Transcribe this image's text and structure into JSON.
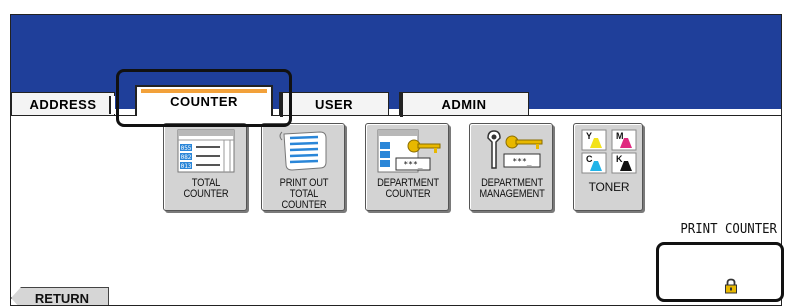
{
  "tabs": [
    {
      "id": "address",
      "label": "ADDRESS"
    },
    {
      "id": "counter",
      "label": "COUNTER"
    },
    {
      "id": "user",
      "label": "USER"
    },
    {
      "id": "admin",
      "label": "ADMIN"
    }
  ],
  "active_tab": "COUNTER",
  "function_buttons": [
    {
      "id": "total-counter",
      "lines": [
        "TOTAL",
        "COUNTER"
      ]
    },
    {
      "id": "print-out-total-counter",
      "lines": [
        "PRINT OUT",
        "TOTAL COUNTER"
      ]
    },
    {
      "id": "department-counter",
      "lines": [
        "DEPARTMENT",
        "COUNTER"
      ]
    },
    {
      "id": "department-management",
      "lines": [
        "DEPARTMENT",
        "MANAGEMENT"
      ]
    },
    {
      "id": "toner",
      "lines": [
        "TONER"
      ]
    }
  ],
  "icon_text": {
    "counter_rows": [
      "055",
      "082",
      "013"
    ],
    "password_mask": "***_",
    "toner_colors": [
      "Y",
      "M",
      "C",
      "K"
    ]
  },
  "section_label": "PRINT COUNTER",
  "return_label": "RETURN",
  "icons": {
    "total_counter": "counter-table-icon",
    "print_out": "printout-scroll-icon",
    "department_counter": "department-key-icon",
    "department_management": "key-password-icon",
    "toner": "toner-cmyk-icon",
    "lock": "padlock-icon"
  },
  "colors": {
    "header": "#1f3f9a",
    "tab_active_accent": "#f2a13a",
    "button_face": "#d3d3d3",
    "counter_blue": "#2a86d8",
    "key_yellow": "#e8b800",
    "toner_yellow": "#f2e21a",
    "toner_magenta": "#e0287f",
    "toner_cyan": "#22b4e8",
    "toner_black": "#111111"
  }
}
